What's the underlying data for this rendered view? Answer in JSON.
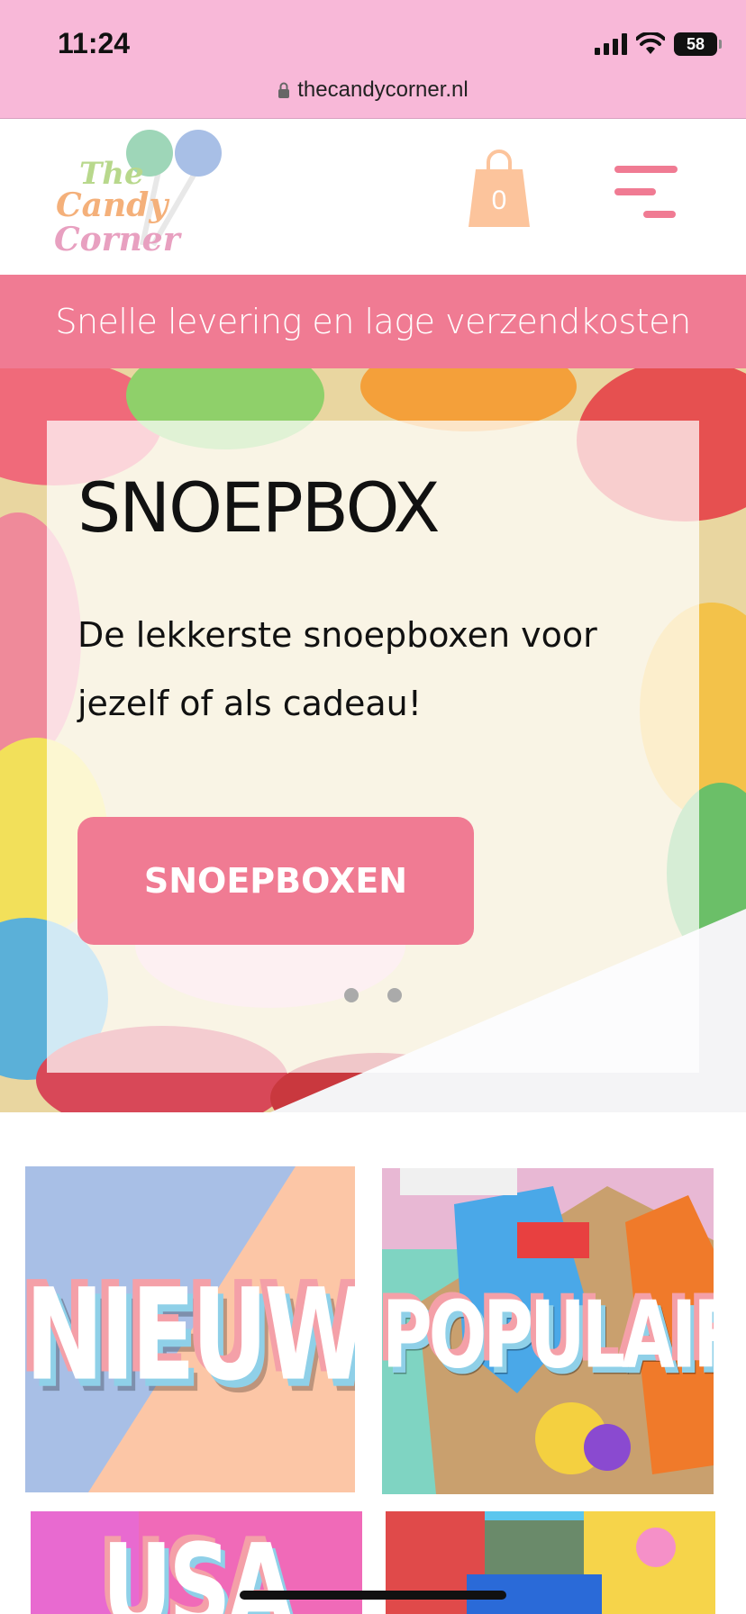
{
  "status_bar": {
    "time": "11:24",
    "battery": "58",
    "url": "thecandycorner.nl",
    "lock_icon": "lock-icon",
    "signal_icon": "cellular-signal-icon",
    "wifi_icon": "wifi-icon"
  },
  "header": {
    "logo_alt": "The Candy Corner",
    "logo_lines": [
      "The",
      "Candy",
      "Corner"
    ],
    "cart_count": "0",
    "cart_icon": "shopping-bag-icon",
    "menu_icon": "hamburger-menu-icon"
  },
  "banner": {
    "text": "Snelle levering en lage verzendkosten"
  },
  "hero": {
    "title": "SNOEPBOX",
    "description": "De lekkerste snoepboxen voor jezelf of als cadeau!",
    "button_label": "SNOEPBOXEN",
    "slide_count": 2,
    "active_slide": 1
  },
  "categories": [
    {
      "label": "NIEUW"
    },
    {
      "label": "POPULAIR"
    },
    {
      "label": "USA"
    },
    {
      "label": ""
    }
  ],
  "colors": {
    "status_bg": "#f8b8d8",
    "accent_pink": "#f07b93",
    "cart_orange": "#fcc49c",
    "tile_blue": "#a8bfe6",
    "tile_peach": "#fcc6a6"
  }
}
